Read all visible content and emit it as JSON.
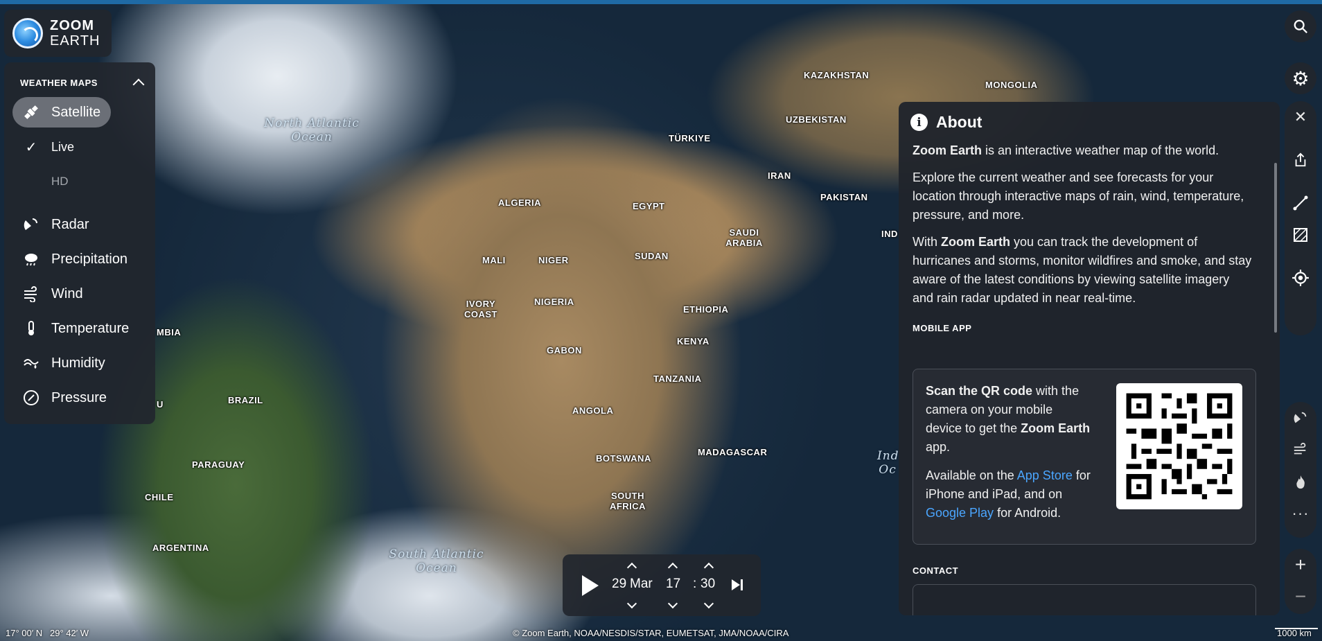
{
  "logo": {
    "line1": "ZOOM",
    "line2": "EARTH"
  },
  "weather_maps": {
    "header": "WEATHER MAPS",
    "items": [
      {
        "label": "Satellite",
        "icon": "satellite-icon"
      },
      {
        "label": "Live",
        "icon": "check-icon"
      },
      {
        "label": "HD",
        "icon": ""
      },
      {
        "label": "Radar",
        "icon": "radar-icon"
      },
      {
        "label": "Precipitation",
        "icon": "rain-cloud-icon"
      },
      {
        "label": "Wind",
        "icon": "wind-icon"
      },
      {
        "label": "Temperature",
        "icon": "thermometer-icon"
      },
      {
        "label": "Humidity",
        "icon": "humidity-icon"
      },
      {
        "label": "Pressure",
        "icon": "pressure-icon"
      }
    ]
  },
  "map_labels": {
    "north_atlantic": "North Atlantic Ocean",
    "south_atlantic": "South Atlantic Ocean",
    "indian": "Ind Oc",
    "kazakhstan": "KAZAKHSTAN",
    "mongolia": "MONGOLIA",
    "uzbekistan": "UZBEKISTAN",
    "turkiye": "TÜRKIYE",
    "iran": "IRAN",
    "pakistan": "PAKISTAN",
    "ind": "IND",
    "algeria": "ALGERIA",
    "egypt": "EGYPT",
    "saudi": "SAUDI ARABIA",
    "mali": "MALI",
    "niger": "NIGER",
    "sudan": "SUDAN",
    "ivory": "IVORY COAST",
    "nigeria": "NIGERIA",
    "ethiopia": "ETHIOPIA",
    "gabon": "GABON",
    "kenya": "KENYA",
    "tanzania": "TANZANIA",
    "angola": "ANGOLA",
    "botswana": "BOTSWANA",
    "madagascar": "MADAGASCAR",
    "south_africa": "SOUTH AFRICA",
    "brazil": "BRAZIL",
    "paraguay": "PARAGUAY",
    "chile": "CHILE",
    "argentina": "ARGENTINA",
    "mbia": "MBIA",
    "u": "U"
  },
  "about": {
    "title": "About",
    "p1_bold": "Zoom Earth",
    "p1_rest": " is an interactive weather map of the world.",
    "p2": "Explore the current weather and see forecasts for your location through interactive maps of rain, wind, temperature, pressure, and more.",
    "p3_pre": "With ",
    "p3_bold": "Zoom Earth",
    "p3_rest": " you can track the development of hurricanes and storms, monitor wildfires and smoke, and stay aware of the latest conditions by viewing satellite imagery and rain radar updated in near real-time.",
    "mobile_header": "MOBILE APP",
    "qr_bold1": "Scan the QR code",
    "qr_text1": " with the camera on your mobile device to get the ",
    "qr_bold2": "Zoom Earth",
    "qr_text2": " app.",
    "avail_pre": "Available on the ",
    "app_store": "App Store",
    "avail_mid": " for iPhone and iPad, and on ",
    "google_play": "Google Play",
    "avail_post": " for Android.",
    "contact_header": "CONTACT"
  },
  "time": {
    "day": "29",
    "month": "Mar",
    "hour": "17",
    "sep": ":",
    "minute": "30"
  },
  "footer": {
    "coords": "17° 00′ N   29° 42′ W",
    "credits": "© Zoom Earth, NOAA/NESDIS/STAR, EUMETSAT, JMA/NOAA/CIRA",
    "scale": "1000 km"
  },
  "toolbar": {
    "search": "search-icon",
    "settings": "gear-icon",
    "close": "close-icon",
    "share": "share-icon",
    "measure": "measure-icon",
    "area": "area-icon",
    "locate": "locate-icon",
    "storms": "storm-icon",
    "wind_layer": "wind-icon",
    "fires": "fire-icon",
    "more": "more-icon",
    "zoom_in": "plus-icon",
    "zoom_out": "minus-icon"
  }
}
